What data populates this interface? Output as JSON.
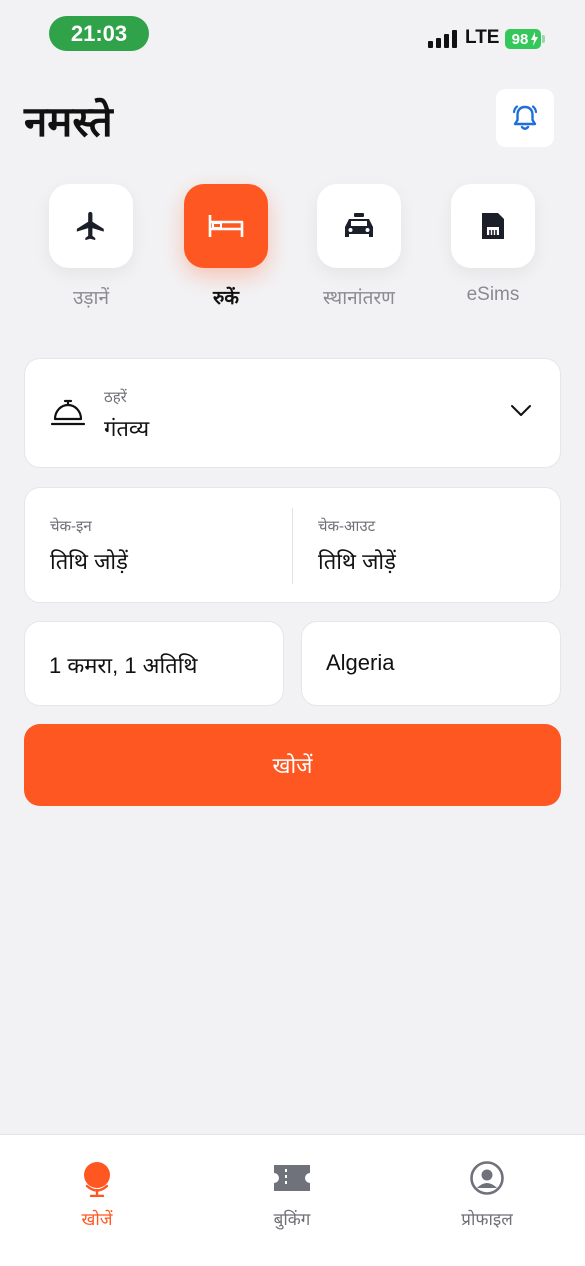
{
  "status_bar": {
    "time": "21:03",
    "network": "LTE",
    "battery": "98"
  },
  "header": {
    "greeting": "नमस्ते"
  },
  "categories": [
    {
      "label": "उड़ानें",
      "icon": "airplane-icon",
      "active": false
    },
    {
      "label": "रुकें",
      "icon": "bed-icon",
      "active": true
    },
    {
      "label": "स्थानांतरण",
      "icon": "taxi-icon",
      "active": false
    },
    {
      "label": "eSims",
      "icon": "sim-card-icon",
      "active": false
    }
  ],
  "destination": {
    "label": "ठहरें",
    "value": "गंतव्य"
  },
  "dates": {
    "checkin_label": "चेक-इन",
    "checkin_value": "तिथि जोड़ें",
    "checkout_label": "चेक-आउट",
    "checkout_value": "तिथि जोड़ें"
  },
  "guests": {
    "value": "1 कमरा, 1 अतिथि"
  },
  "country": {
    "value": "Algeria"
  },
  "search_button": {
    "label": "खोजें"
  },
  "bottom_nav": [
    {
      "label": "खोजें",
      "icon": "globe-icon",
      "active": true
    },
    {
      "label": "बुकिंग",
      "icon": "ticket-icon",
      "active": false
    },
    {
      "label": "प्रोफाइल",
      "icon": "profile-icon",
      "active": false
    }
  ],
  "colors": {
    "accent": "#ff5722",
    "status_pill": "#30a24a",
    "bell": "#1e6fd9"
  }
}
